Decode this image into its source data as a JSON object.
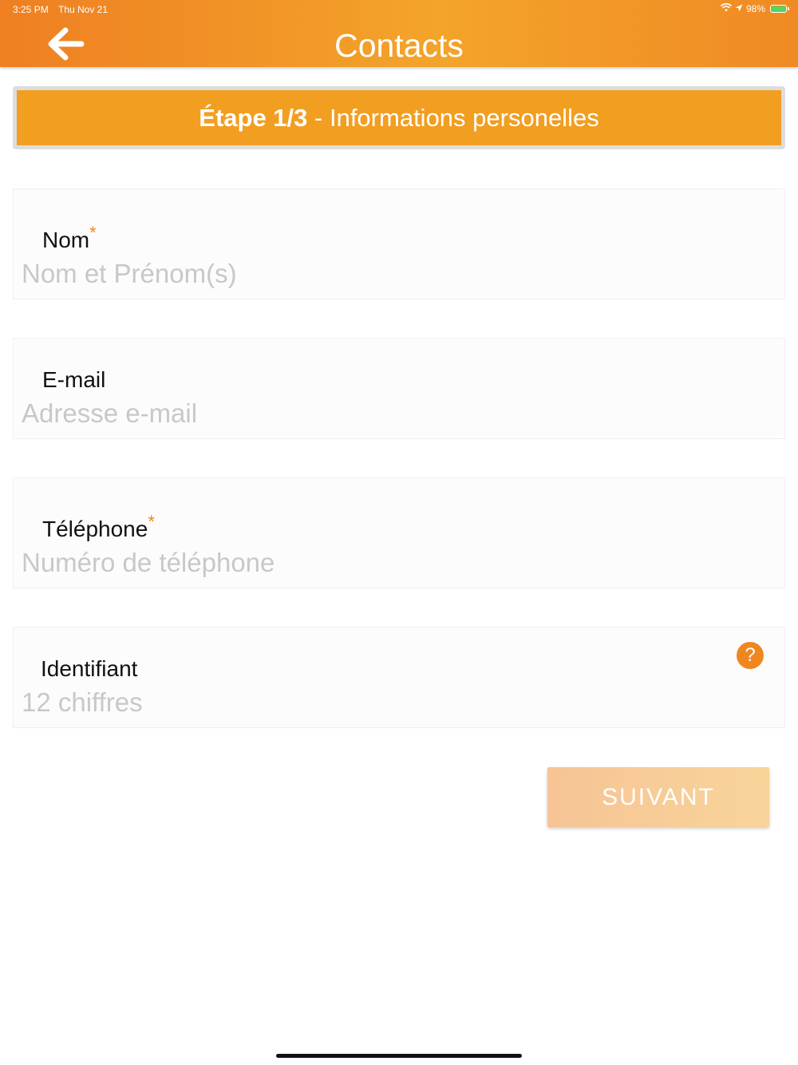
{
  "status_bar": {
    "time": "3:25 PM",
    "date": "Thu Nov 21",
    "battery": "98%",
    "battery_level": 0.98
  },
  "header": {
    "title": "Contacts",
    "back_icon": "arrow-left-icon",
    "accent_start": "#ef7f22",
    "accent_end": "#f3a42a"
  },
  "step": {
    "step_label": "Étape 1/3",
    "separator": " - ",
    "title": "Informations personelles",
    "color": "#f29e20"
  },
  "form": {
    "name": {
      "label": "Nom",
      "required_mark": "*",
      "placeholder": "Nom et Prénom(s)"
    },
    "email": {
      "label": "E-mail",
      "placeholder": "Adresse e-mail"
    },
    "phone": {
      "label": "Téléphone",
      "required_mark": "*",
      "placeholder": "Numéro de téléphone"
    },
    "identifier": {
      "label": "Identifiant",
      "placeholder": "12 chiffres",
      "help_icon": "question-mark-icon",
      "help_glyph": "?"
    }
  },
  "actions": {
    "next_label": "SUIVANT"
  }
}
